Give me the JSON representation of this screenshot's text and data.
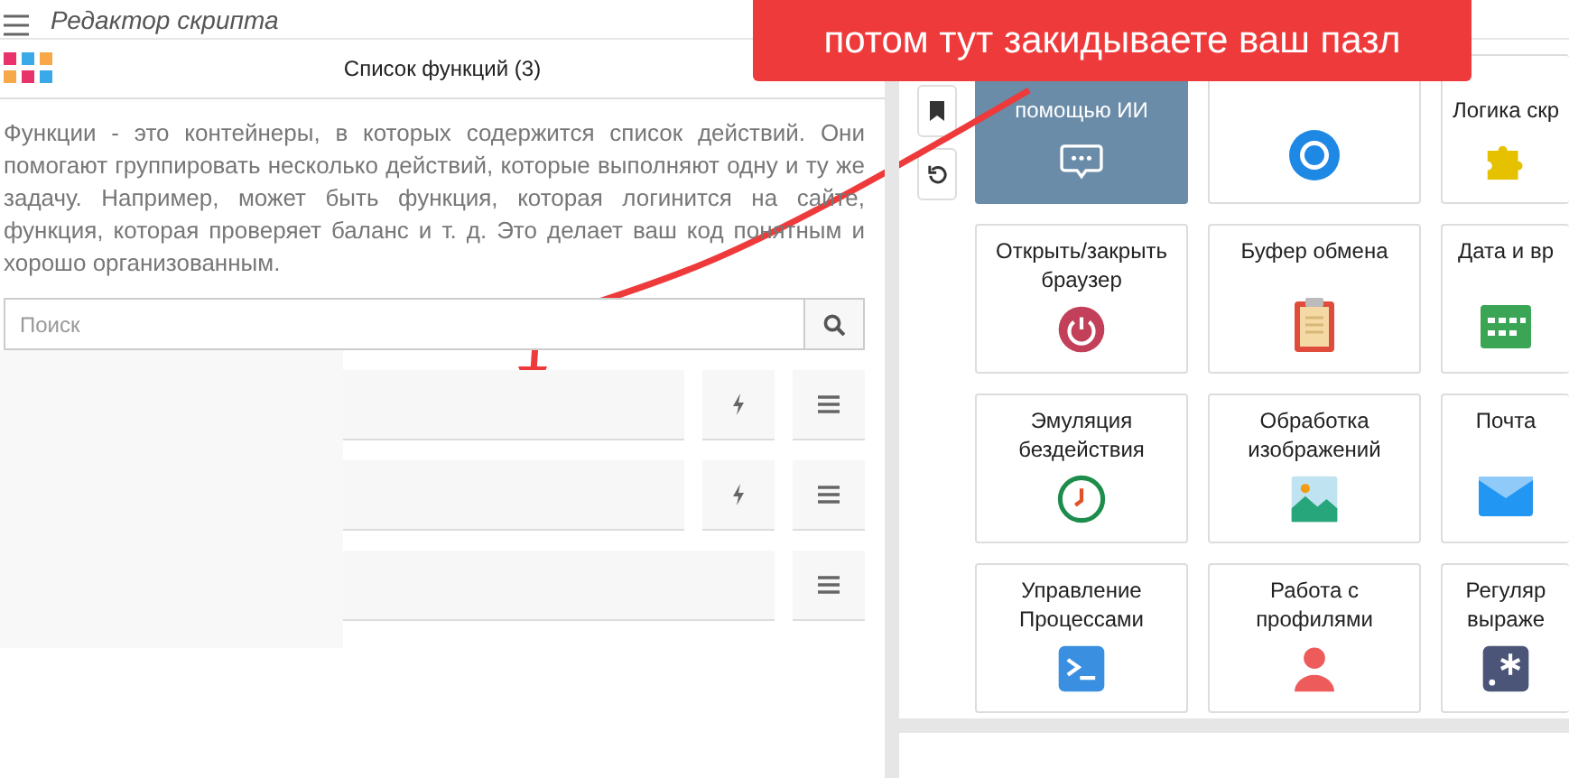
{
  "header": {
    "title": "Редактор скрипта"
  },
  "functions_panel": {
    "title": "Список функций (3)",
    "description": "Функции - это контейнеры, в которых содержится список действий. Они помогают группировать несколько действий, которые выполняют одну и ту же задачу. Например, может быть функция, которая логинится на сайте, функция, которая проверяет баланс и т. д. Это делает ваш код понятным и хорошо организованным.",
    "search": {
      "placeholder": "Поиск"
    },
    "functions": [
      {
        "runnable": true
      },
      {
        "runnable": true
      },
      {
        "runnable": false
      }
    ]
  },
  "tiles": [
    {
      "label": "помощью ИИ",
      "selected": true
    },
    {
      "selected": false
    },
    {
      "label": "Логика скр",
      "selected": false
    },
    {
      "label": "Открыть/закрыть браузер",
      "selected": false
    },
    {
      "label": "Буфер обмена",
      "selected": false
    },
    {
      "label": "Дата и вр",
      "selected": false
    },
    {
      "label": "Эмуляция бездействия",
      "selected": false
    },
    {
      "label": "Обработка изображений",
      "selected": false
    },
    {
      "label": "Почта",
      "selected": false
    },
    {
      "label": "Управление Процессами",
      "selected": false
    },
    {
      "label": "Работа с профилями",
      "selected": false
    },
    {
      "label": "Регуляр выраже",
      "selected": false
    }
  ],
  "callout": {
    "text": "потом тут закидываете ваш пазл"
  }
}
